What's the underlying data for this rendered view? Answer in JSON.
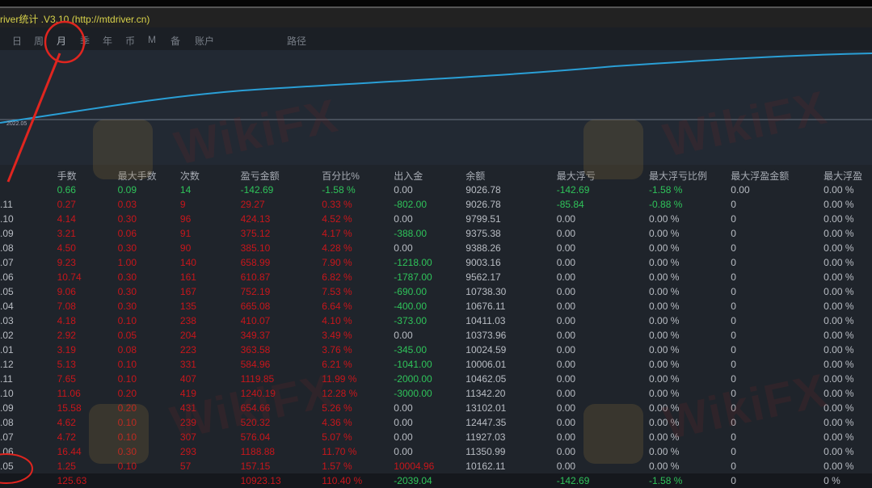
{
  "window": {
    "title": "river统计 .V3.10 (http://mtdriver.cn)"
  },
  "nav": {
    "tabs": [
      "日",
      "周",
      "月",
      "季",
      "年",
      "币",
      "M",
      "备",
      "账户"
    ],
    "path_label": "路径",
    "active": "月"
  },
  "chart": {
    "date_label": "2022.05"
  },
  "watermark": "WikiFX",
  "colors": {
    "red": "#c8161b",
    "green": "#2fc35a",
    "line": "#2a9fd6"
  },
  "table": {
    "headers": [
      "",
      "手数",
      "最大手数",
      "次数",
      "盈亏金额",
      "百分比%",
      "出入金",
      "余额",
      "最大浮亏",
      "最大浮亏比例",
      "最大浮盈金额",
      "最大浮盈"
    ],
    "rows": [
      [
        "",
        "0.66",
        "0.09",
        "14",
        "-142.69",
        "-1.58 %",
        "0.00",
        "9026.78",
        "-142.69",
        "-1.58 %",
        "0.00",
        "0.00 %"
      ],
      [
        ".11",
        "0.27",
        "0.03",
        "9",
        "29.27",
        "0.33 %",
        "-802.00",
        "9026.78",
        "-85.84",
        "-0.88 %",
        "0",
        "0.00 %"
      ],
      [
        ".10",
        "4.14",
        "0.30",
        "96",
        "424.13",
        "4.52 %",
        "0.00",
        "9799.51",
        "0.00",
        "0.00 %",
        "0",
        "0.00 %"
      ],
      [
        ".09",
        "3.21",
        "0.06",
        "91",
        "375.12",
        "4.17 %",
        "-388.00",
        "9375.38",
        "0.00",
        "0.00 %",
        "0",
        "0.00 %"
      ],
      [
        ".08",
        "4.50",
        "0.30",
        "90",
        "385.10",
        "4.28 %",
        "0.00",
        "9388.26",
        "0.00",
        "0.00 %",
        "0",
        "0.00 %"
      ],
      [
        ".07",
        "9.23",
        "1.00",
        "140",
        "658.99",
        "7.90 %",
        "-1218.00",
        "9003.16",
        "0.00",
        "0.00 %",
        "0",
        "0.00 %"
      ],
      [
        ".06",
        "10.74",
        "0.30",
        "161",
        "610.87",
        "6.82 %",
        "-1787.00",
        "9562.17",
        "0.00",
        "0.00 %",
        "0",
        "0.00 %"
      ],
      [
        ".05",
        "9.06",
        "0.30",
        "167",
        "752.19",
        "7.53 %",
        "-690.00",
        "10738.30",
        "0.00",
        "0.00 %",
        "0",
        "0.00 %"
      ],
      [
        ".04",
        "7.08",
        "0.30",
        "135",
        "665.08",
        "6.64 %",
        "-400.00",
        "10676.11",
        "0.00",
        "0.00 %",
        "0",
        "0.00 %"
      ],
      [
        ".03",
        "4.18",
        "0.10",
        "238",
        "410.07",
        "4.10 %",
        "-373.00",
        "10411.03",
        "0.00",
        "0.00 %",
        "0",
        "0.00 %"
      ],
      [
        ".02",
        "2.92",
        "0.05",
        "204",
        "349.37",
        "3.49 %",
        "0.00",
        "10373.96",
        "0.00",
        "0.00 %",
        "0",
        "0.00 %"
      ],
      [
        ".01",
        "3.19",
        "0.08",
        "223",
        "363.58",
        "3.76 %",
        "-345.00",
        "10024.59",
        "0.00",
        "0.00 %",
        "0",
        "0.00 %"
      ],
      [
        ".12",
        "5.13",
        "0.10",
        "331",
        "584.96",
        "6.21 %",
        "-1041.00",
        "10006.01",
        "0.00",
        "0.00 %",
        "0",
        "0.00 %"
      ],
      [
        ".11",
        "7.65",
        "0.10",
        "407",
        "1119.85",
        "11.99 %",
        "-2000.00",
        "10462.05",
        "0.00",
        "0.00 %",
        "0",
        "0.00 %"
      ],
      [
        ".10",
        "11.06",
        "0.20",
        "419",
        "1240.19",
        "12.28 %",
        "-3000.00",
        "11342.20",
        "0.00",
        "0.00 %",
        "0",
        "0.00 %"
      ],
      [
        ".09",
        "15.58",
        "0.20",
        "431",
        "654.66",
        "5.26 %",
        "0.00",
        "13102.01",
        "0.00",
        "0.00 %",
        "0",
        "0.00 %"
      ],
      [
        ".08",
        "4.62",
        "0.10",
        "239",
        "520.32",
        "4.36 %",
        "0.00",
        "12447.35",
        "0.00",
        "0.00 %",
        "0",
        "0.00 %"
      ],
      [
        ".07",
        "4.72",
        "0.10",
        "307",
        "576.04",
        "5.07 %",
        "0.00",
        "11927.03",
        "0.00",
        "0.00 %",
        "0",
        "0.00 %"
      ],
      [
        ".06",
        "16.44",
        "0.30",
        "293",
        "1188.88",
        "11.70 %",
        "0.00",
        "11350.99",
        "0.00",
        "0.00 %",
        "0",
        "0.00 %"
      ],
      [
        ".05",
        "1.25",
        "0.10",
        "57",
        "157.15",
        "1.57 %",
        "10004.96",
        "10162.11",
        "0.00",
        "0.00 %",
        "0",
        "0.00 %"
      ]
    ],
    "total": [
      "",
      "125.63",
      "",
      "",
      "10923.13",
      "110.40 %",
      "-2039.04",
      "",
      "-142.69",
      "-1.58 %",
      "0",
      "0 %"
    ]
  }
}
